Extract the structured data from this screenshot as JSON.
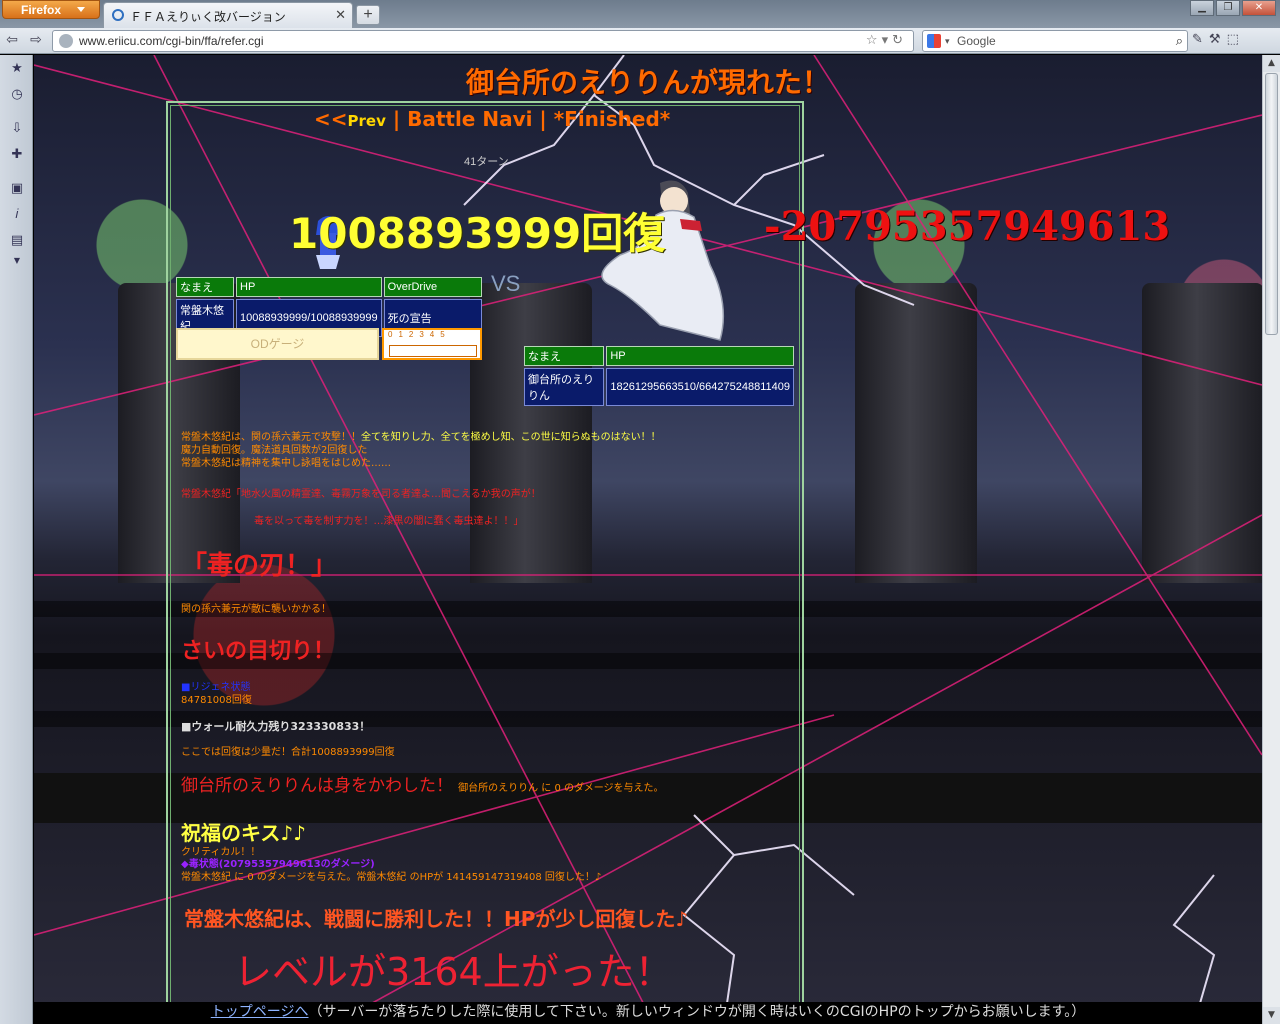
{
  "browser": {
    "app_button": "Firefox",
    "tab_title": "ＦＦＡえりぃく改バージョン",
    "url": "www.eriicu.com/cgi-bin/ffa/refer.cgi",
    "search_placeholder": "Google"
  },
  "battle": {
    "headline": "御台所のえりりんが現れた！",
    "nav": {
      "prev_arrows": "<<",
      "prev": "Prev",
      "sep1": " | ",
      "battle_navi": "Battle Navi",
      "sep2": " | ",
      "finished": "*Finished*"
    },
    "turn": "41ターン",
    "heal_popup": "1008893999回復",
    "damage_popup": "-20795357949613",
    "vs": "VS",
    "player": {
      "headers": {
        "name": "なまえ",
        "hp": "HP",
        "overdrive": "OverDrive"
      },
      "name": "常盤木悠紀",
      "hp": "10088939999/10088939999",
      "overdrive": "死の宣告",
      "od_gauge_label": "ODゲージ",
      "od_scale": "012345",
      "od_fill_fraction": 0
    },
    "enemy": {
      "headers": {
        "name": "なまえ",
        "hp": "HP"
      },
      "name": "御台所のえりりん",
      "hp": "18261295663510/664275248811409"
    },
    "log": {
      "l1a": "常盤木悠紀は、関の孫六兼元で攻撃！！",
      "l1b": "全てを知りし力、全てを極めし知、この世に知らぬものはない！！",
      "l2": "魔力自動回復。魔法道具回数が2回復した",
      "l3": "常盤木悠紀は精神を集中し詠唱をはじめた……",
      "l4": "常盤木悠紀「地水火風の精霊達、毒霧万象を司る者達よ…聞こえるか我の声が！",
      "l5": "毒を以って毒を制す力を！…漆黒の闇に蠢く毒虫達よ！！」",
      "skill1": "「毒の刃！」",
      "l6": "関の孫六兼元が敵に襲いかかる！",
      "skill2": "さいの目切り！",
      "l7": "■リジェネ状態",
      "l8": "84781008回復",
      "l9": "■ウォール耐久力残り323330833！",
      "l10": "ここでは回復は少量だ！合計1008893999回復",
      "dodge": "御台所のえりりんは身をかわした！",
      "dodge_detail": "御台所のえりりん に 0 のダメージを与えた。",
      "skill3": "祝福のキス♪♪",
      "crit": "クリティカル！！",
      "poison": "◆毒状態(20795357949613のダメージ)",
      "l11": "常盤木悠紀 に 0 のダメージを与えた。常盤木悠紀 のHPが 141459147319408 回復した！♪",
      "victory": "常盤木悠紀は、戦闘に勝利した！！HPが少し回復した♪",
      "levelup": "レベルが3164上がった！"
    }
  },
  "footer": {
    "link": "トップページへ",
    "note": "（サーバーが落ちたりした際に使用して下さい。新しいウィンドウが開く時はいくのCGIのHPのトップからお願いします。）"
  }
}
